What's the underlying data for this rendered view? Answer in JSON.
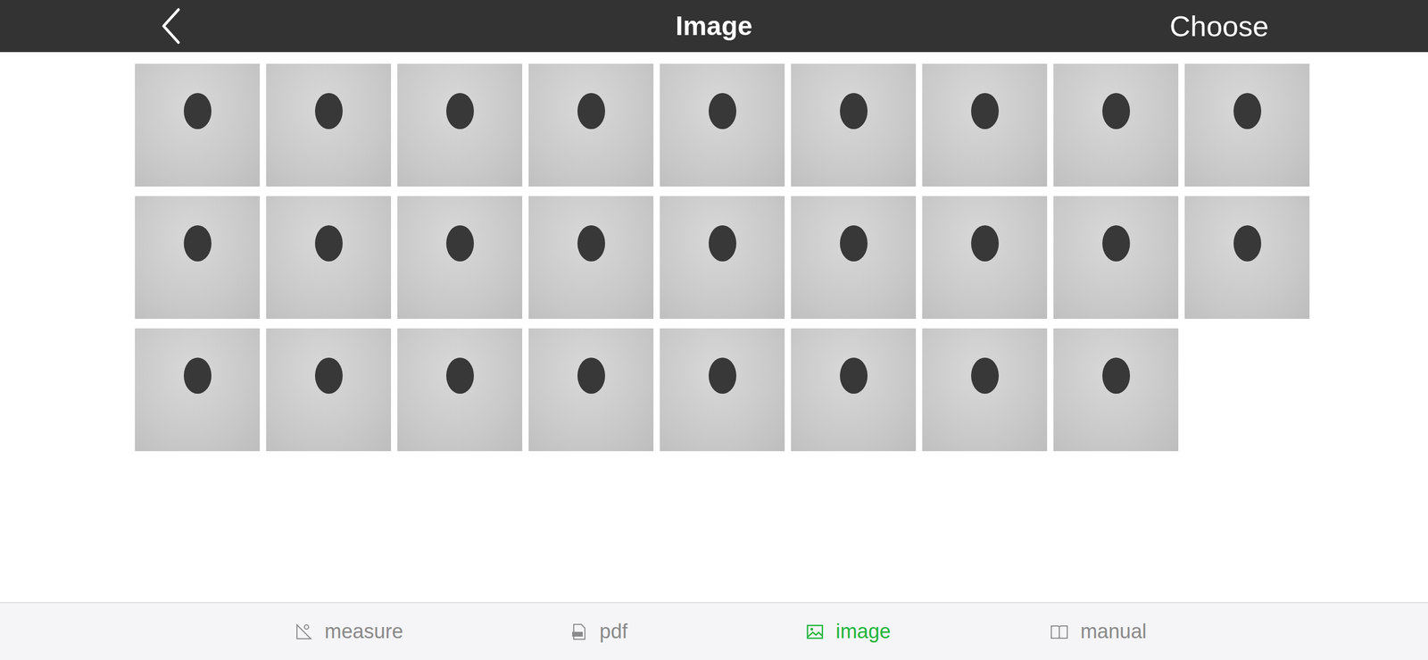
{
  "window": {
    "title": "Image"
  },
  "top_bar": {
    "back": true,
    "action": "Choose"
  },
  "images": [
    {
      "kind": "photo"
    },
    {
      "kind": "photo"
    },
    {
      "kind": "photo"
    },
    {
      "kind": "photo"
    },
    {
      "kind": "photo"
    },
    {
      "kind": "photo"
    },
    {
      "kind": "photo"
    },
    {
      "kind": "photo"
    },
    {
      "kind": "photo"
    },
    {
      "kind": "photo"
    },
    {
      "kind": "photo"
    },
    {
      "kind": "photo"
    },
    {
      "kind": "photo"
    },
    {
      "kind": "photo"
    },
    {
      "kind": "photo"
    },
    {
      "kind": "photo"
    },
    {
      "kind": "photo"
    },
    {
      "kind": "photo"
    },
    {
      "kind": "photo"
    },
    {
      "kind": "photo"
    },
    {
      "kind": "photo"
    },
    {
      "kind": "photo"
    },
    {
      "kind": "photo"
    },
    {
      "kind": "photo"
    },
    {
      "kind": "photo"
    },
    {
      "kind": "photo"
    }
  ],
  "tabs": [
    {
      "label": "measure",
      "selected": false,
      "kind": "measure"
    },
    {
      "label": "pdf",
      "selected": false,
      "kind": "pdf"
    },
    {
      "label": "image",
      "selected": true,
      "kind": "image"
    },
    {
      "label": "manual",
      "selected": false,
      "kind": "manual"
    }
  ]
}
